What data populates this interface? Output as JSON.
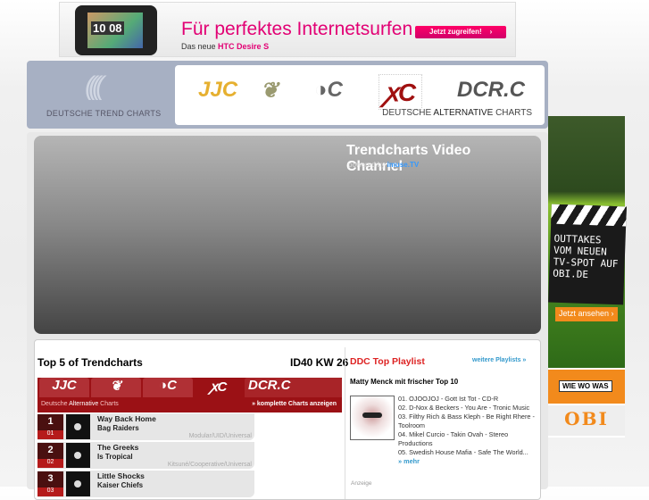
{
  "top_ad": {
    "headline": "Für perfektes Internetsurfen",
    "sub_prefix": "Das neue",
    "sub_product": "HTC Desire S",
    "button": "Jetzt zugreifen!",
    "clock": "10 08"
  },
  "header": {
    "brand": "DEUTSCHE TREND CHARTS",
    "logos": [
      "DDC",
      "DHC",
      "DDC2",
      "DAC",
      "DCRC"
    ],
    "logo_text": [
      "JJC",
      "❦",
      "◑C",
      "ꭗC",
      "DCR.C"
    ],
    "active_name_prefix": "DEUTSCHE",
    "active_name_bold": "ALTERNATIVE",
    "active_name_suffix": "CHARTS"
  },
  "video": {
    "title": "Trendcharts Video Channel",
    "powered_prefix": "powered by",
    "powered_brand": "imuse.TV"
  },
  "top5": {
    "title": "Top 5 of Trendcharts",
    "week": "ID40 KW 26",
    "tabs": [
      "JJC",
      "❦",
      "◑C",
      "ꭗC",
      "DCR.C"
    ],
    "active_tab": 3,
    "chart_prefix": "Deutsche",
    "chart_bold": "Alternative",
    "chart_suffix": "Charts",
    "more": "» komplette Charts anzeigen",
    "rows": [
      {
        "rank": "1",
        "prev": "01",
        "song": "Way Back Home",
        "artist": "Bag Raiders",
        "label": "Modular/UID/Universal"
      },
      {
        "rank": "2",
        "prev": "02",
        "song": "The Greeks",
        "artist": "Is Tropical",
        "label": "Kitsuné/Cooperative/Universal"
      },
      {
        "rank": "3",
        "prev": "03",
        "song": "Little Shocks",
        "artist": "Kaiser Chiefs",
        "label": ""
      }
    ]
  },
  "playlist": {
    "title": "DDC Top Playlist",
    "more": "weitere Playlists »",
    "subtitle": "Matty Menck mit frischer Top 10",
    "items": [
      "01. OJOOJOJ - Gott Ist Tot - CD-R",
      "02. D-Nox & Beckers - You Are - Tronic Music",
      "03. Filthy Rich & Bass Kleph - Be Right Rhere - Toolroom",
      "04. Mikel Curcio - Takin Ovah - Stereo Productions",
      "05. Swedish House Mafia - Safe The World..."
    ],
    "mehr": "» mehr",
    "anzeige": "Anzeige"
  },
  "side_ad": {
    "text": "OUTTAKES VOM NEUEN TV-SPOT AUF OBI.DE",
    "button": "Jetzt ansehen ›",
    "wie": "WIE WO WAS",
    "brand": "OBI"
  }
}
